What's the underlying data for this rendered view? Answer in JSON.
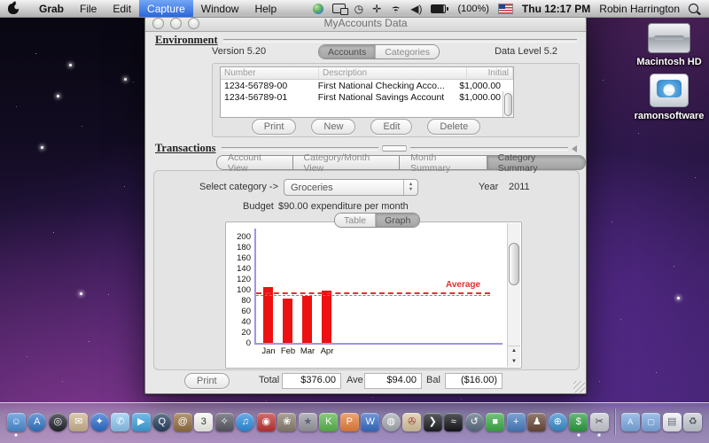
{
  "menubar": {
    "menus": [
      "Grab",
      "File",
      "Edit",
      "Capture",
      "Window",
      "Help"
    ],
    "active_menu": "Capture",
    "battery_label": "(100%)",
    "clock": "Thu 12:17 PM",
    "username": "Robin Harrington"
  },
  "desktop_icons": {
    "hd_label": "Macintosh HD",
    "ext_label": "ramonsoftware"
  },
  "window": {
    "title": "MyAccounts Data",
    "environment": {
      "section_label": "Environment",
      "version": "Version 5.20",
      "data_level": "Data Level 5.2",
      "tab_accounts": "Accounts",
      "tab_categories": "Categories",
      "selected_tab": "Accounts",
      "table": {
        "col_number": "Number",
        "col_description": "Description",
        "col_initial": "Initial",
        "rows": [
          {
            "number": "1234-56789-00",
            "description": "First National Checking Acco...",
            "initial": "$1,000.00"
          },
          {
            "number": "1234-56789-01",
            "description": "First National Savings Account",
            "initial": "$1,000.00"
          }
        ]
      },
      "btn_print": "Print",
      "btn_new": "New",
      "btn_edit": "Edit",
      "btn_delete": "Delete"
    },
    "transactions": {
      "section_label": "Transactions",
      "tabs": [
        "Account View",
        "Category/Month View",
        "Month Summary",
        "Category Summary"
      ],
      "selected_tab": "Category Summary",
      "select_category_label": "Select category ->",
      "category_value": "Groceries",
      "year_label": "Year",
      "year_value": "2011",
      "budget_label": "Budget",
      "budget_value": "$90.00 expenditure per month",
      "view_tab_table": "Table",
      "view_tab_graph": "Graph",
      "selected_view_tab": "Graph",
      "btn_print": "Print",
      "total_label": "Total",
      "total_value": "$376.00",
      "ave_label": "Ave",
      "ave_value": "$94.00",
      "bal_label": "Bal",
      "bal_value": "($16.00)"
    }
  },
  "chart_data": {
    "type": "bar",
    "title": "",
    "categories": [
      "Jan",
      "Feb",
      "Mar",
      "Apr"
    ],
    "values": [
      105,
      84,
      89,
      98
    ],
    "yticks": [
      0,
      20,
      40,
      60,
      80,
      100,
      120,
      140,
      160,
      180,
      200
    ],
    "ylim": [
      0,
      210
    ],
    "xlabel": "",
    "ylabel": "",
    "grid": false,
    "bar_color": "#ee1111",
    "axis_color": "#9a97e6",
    "average_line": {
      "value": 94,
      "label": "Average",
      "color": "#e03030"
    },
    "budget_line": {
      "value": 90,
      "color": "#3db53d"
    }
  },
  "dock": {
    "items": [
      {
        "name": "finder",
        "glyph": "☺",
        "color": "#4b8fd5",
        "running": true
      },
      {
        "name": "app-store",
        "glyph": "A",
        "color": "#3578c8",
        "round": true
      },
      {
        "name": "dashboard",
        "glyph": "◎",
        "color": "#23262e",
        "round": true
      },
      {
        "name": "mail",
        "glyph": "✉",
        "color": "#cdb690"
      },
      {
        "name": "safari",
        "glyph": "✦",
        "color": "#2f6fd0",
        "round": true
      },
      {
        "name": "ichat",
        "glyph": "✆",
        "color": "#8ec8f2"
      },
      {
        "name": "facetime",
        "glyph": "▶",
        "color": "#3fa3e0"
      },
      {
        "name": "quicktime",
        "glyph": "Q",
        "color": "#27415f",
        "round": true
      },
      {
        "name": "address-book",
        "glyph": "@",
        "color": "#96713f"
      },
      {
        "name": "ical",
        "glyph": "3",
        "color": "#f7f7f2",
        "fg": "#333"
      },
      {
        "name": "photo-booth",
        "glyph": "✧",
        "color": "#5a5a66"
      },
      {
        "name": "itunes",
        "glyph": "♫",
        "color": "#2f8fe0",
        "round": true
      },
      {
        "name": "dvd-player",
        "glyph": "◉",
        "color": "#c23535"
      },
      {
        "name": "iphoto",
        "glyph": "❀",
        "color": "#8a8070"
      },
      {
        "name": "imovie",
        "glyph": "★",
        "color": "#9a9aa2",
        "fg": "#5a5f73"
      },
      {
        "name": "keynote",
        "glyph": "K",
        "color": "#5cb84e"
      },
      {
        "name": "powerpoint",
        "glyph": "P",
        "color": "#e8823c"
      },
      {
        "name": "word",
        "glyph": "W",
        "color": "#3a6fc8"
      },
      {
        "name": "messenger",
        "glyph": "◍",
        "color": "#a8adb5",
        "round": true
      },
      {
        "name": "certificate",
        "glyph": "✇",
        "color": "#d8c8a0",
        "fg": "#a33333"
      },
      {
        "name": "terminal",
        "glyph": "❯",
        "color": "#1d1f22"
      },
      {
        "name": "activity-monitor",
        "glyph": "≈",
        "color": "#14161a"
      },
      {
        "name": "time-machine",
        "glyph": "↺",
        "color": "#5a6f82",
        "round": true
      },
      {
        "name": "green-cube-app",
        "glyph": "■",
        "color": "#3fae4a"
      },
      {
        "name": "xcode",
        "glyph": "+",
        "color": "#4a7fc0"
      },
      {
        "name": "game-character",
        "glyph": "♟",
        "color": "#6b4a3a"
      },
      {
        "name": "earth-app",
        "glyph": "⊕",
        "color": "#3a8fd0",
        "round": true
      },
      {
        "name": "cash-register-app",
        "glyph": "$",
        "color": "#2f9e44",
        "running": true
      },
      {
        "name": "grab",
        "glyph": "✂",
        "color": "#c9ccd4",
        "fg": "#444",
        "running": true
      },
      {
        "name": "separator",
        "kind": "separator"
      },
      {
        "name": "applications-folder",
        "glyph": "A",
        "kind": "folder"
      },
      {
        "name": "documents-folder",
        "glyph": "▢",
        "kind": "folder"
      },
      {
        "name": "documents-stack",
        "glyph": "▤",
        "color": "#eceff3",
        "fg": "#667"
      },
      {
        "name": "trash",
        "glyph": "♻",
        "color": "#c7cdd4",
        "fg": "#555"
      }
    ]
  }
}
